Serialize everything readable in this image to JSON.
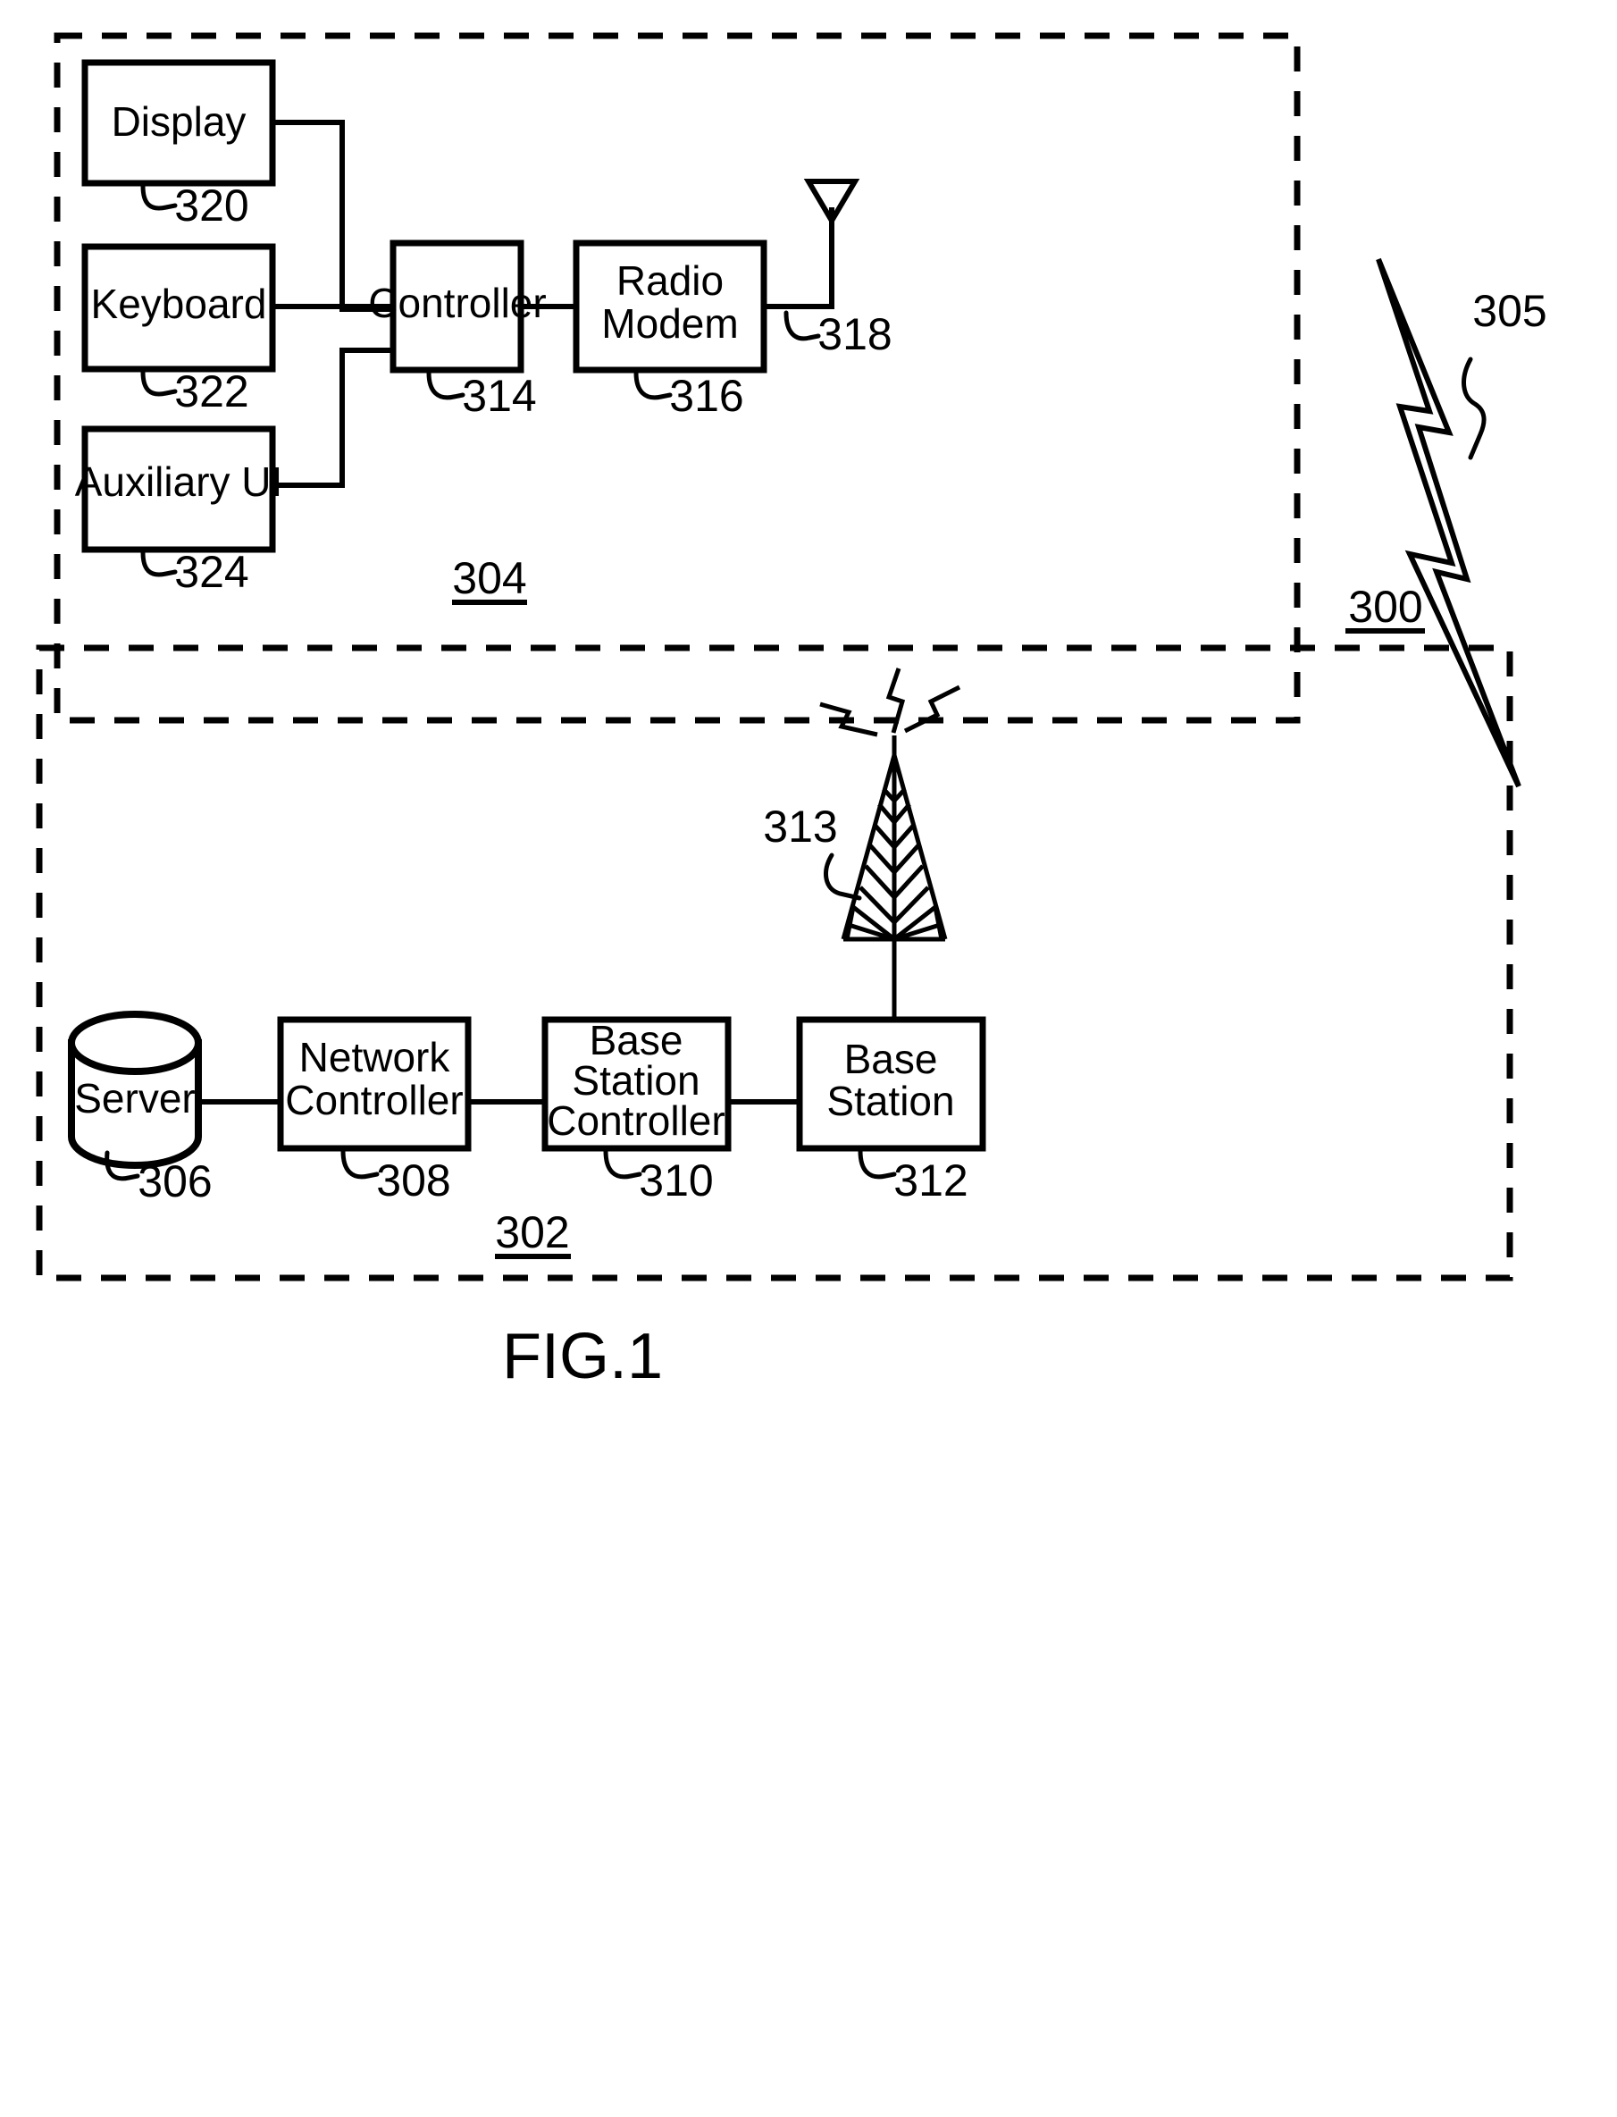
{
  "figure": {
    "caption": "FIG.1",
    "system_ref": "300",
    "rf_link_ref": "305"
  },
  "mobile_panel": {
    "ref": "304",
    "blocks": [
      {
        "id": "display",
        "label": "Display",
        "ref": "320"
      },
      {
        "id": "keyboard",
        "label": "Keyboard",
        "ref": "322"
      },
      {
        "id": "auxiliary_ui",
        "label": "Auxiliary UI",
        "ref": "324"
      },
      {
        "id": "controller",
        "label": "Controller",
        "ref": "314"
      },
      {
        "id": "radio_modem",
        "label_line1": "Radio",
        "label_line2": "Modem",
        "ref": "316"
      }
    ],
    "antenna": {
      "label": "antenna",
      "ref": "318"
    }
  },
  "network_panel": {
    "ref": "302",
    "blocks": [
      {
        "id": "server",
        "label": "Server",
        "ref": "306"
      },
      {
        "id": "network_controller",
        "label_line1": "Network",
        "label_line2": "Controller",
        "ref": "308"
      },
      {
        "id": "base_station_controller",
        "label_line1": "Base",
        "label_line2": "Station",
        "label_line3": "Controller",
        "ref": "310"
      },
      {
        "id": "base_station",
        "label_line1": "Base",
        "label_line2": "Station",
        "ref": "312"
      }
    ],
    "tower": {
      "label": "cell-tower",
      "ref": "313"
    }
  },
  "colors": {
    "ink": "#000000",
    "paper": "#ffffff"
  }
}
